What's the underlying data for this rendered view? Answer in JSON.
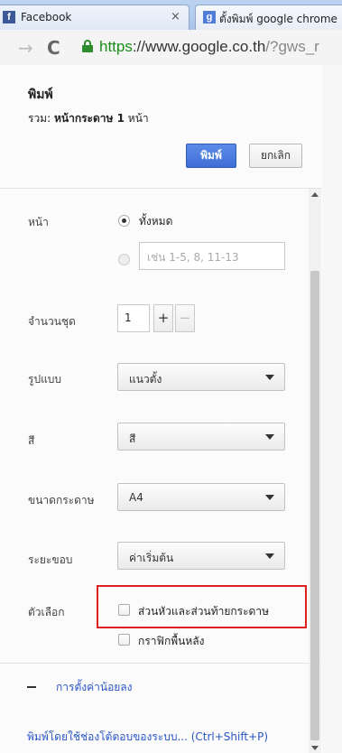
{
  "browser": {
    "tabs": [
      {
        "title": "Facebook",
        "favicon": "facebook-icon",
        "close": "×",
        "active": false
      },
      {
        "title": "ตั้งพิมพ์ google chrome",
        "favicon": "google-icon",
        "active": true
      }
    ],
    "address": {
      "scheme": "https",
      "separator": "://",
      "host": "www.google.co.th",
      "path": "/?gws_r"
    }
  },
  "print_dialog": {
    "title": "พิมพ์",
    "total_prefix": "รวม:",
    "total_value": "หน้ากระดาษ 1",
    "total_suffix": "หน้า",
    "print_button": "พิมพ์",
    "cancel_button": "ยกเลิก",
    "pages": {
      "label": "หน้า",
      "option_all": "ทั้งหมด",
      "option_range_placeholder": "เช่น 1-5, 8, 11-13",
      "selected": "all"
    },
    "copies": {
      "label": "จำนวนชุด",
      "value": "1",
      "plus": "+",
      "minus": "−"
    },
    "layout": {
      "label": "รูปแบบ",
      "value": "แนวตั้ง"
    },
    "color": {
      "label": "สี",
      "value": "สี"
    },
    "paper_size": {
      "label": "ขนาดกระดาษ",
      "value": "A4"
    },
    "margins": {
      "label": "ระยะขอบ",
      "value": "ค่าเริ่มต้น"
    },
    "options": {
      "label": "ตัวเลือก",
      "headers_footers": {
        "label": "ส่วนหัวและส่วนท้ายกระดาษ",
        "checked": false
      },
      "background_graphics": {
        "label": "กราฟิกพื้นหลัง",
        "checked": false
      }
    },
    "fewer_settings_link": "การตั้งค่าน้อยลง",
    "system_dialog_link": "พิมพ์โดยใช้ช่องโต้ตอบของระบบ... (Ctrl+Shift+P)"
  },
  "colors": {
    "print_button": "#4a7ee0",
    "link": "#2a56c6",
    "highlight_box": "#e02020",
    "secure_green": "#1a8f1a"
  }
}
